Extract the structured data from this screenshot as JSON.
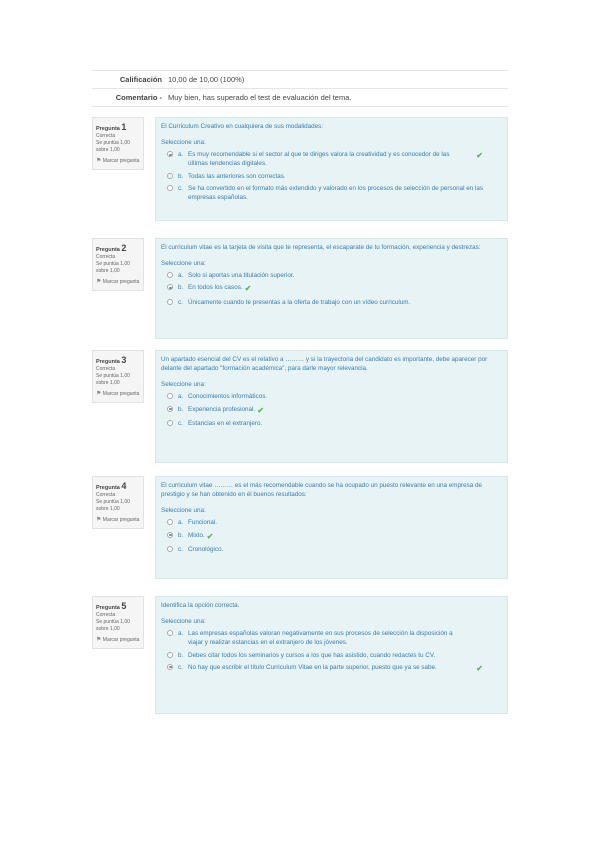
{
  "summary": [
    {
      "label": "Calificación",
      "value": "10,00 de 10,00 (100%)"
    },
    {
      "label": "Comentario -",
      "value": "Muy bien, has superado el test de evaluación del tema."
    }
  ],
  "questions": [
    {
      "label": "Pregunta",
      "number": "1",
      "status": "Correcta",
      "score": "Se puntúa 1,00 sobre 1,00",
      "flag": "Marcar pregunta",
      "text": "El Curriculum Creativo en cualquiera de sus modalidades:",
      "prompt": "Seleccione una:",
      "answers": [
        {
          "letter": "a.",
          "text": "Es muy recomendable si el sector al que te diriges valora la creatividad y es conocedor de las últimas tendencias digitales.",
          "selected": true,
          "correct": true
        },
        {
          "letter": "b.",
          "text": "Todas las anteriores son correctas.",
          "selected": false,
          "correct": false
        },
        {
          "letter": "c.",
          "text": "Se ha convertido en el formato más extendido y valorado en los procesos de selección de personal en las empresas españolas.",
          "selected": false,
          "correct": false
        }
      ]
    },
    {
      "label": "Pregunta",
      "number": "2",
      "status": "Correcta",
      "score": "Se puntúa 1,00 sobre 1,00",
      "flag": "Marcar pregunta",
      "text": "El curriculum vitae es la tarjeta de visita que te representa, el escaparate de tu formación, experiencia y destrezas:",
      "prompt": "Seleccione una:",
      "answers": [
        {
          "letter": "a.",
          "text": "Solo si aportas una titulación superior.",
          "selected": false,
          "correct": false
        },
        {
          "letter": "b.",
          "text": "En todos los casos.",
          "selected": true,
          "correct": true
        },
        {
          "letter": "c.",
          "text": "Únicamente cuando te presentas a la oferta de trabajo con un vídeo curriculum.",
          "selected": false,
          "correct": false
        }
      ]
    },
    {
      "label": "Pregunta",
      "number": "3",
      "status": "Correcta",
      "score": "Se puntúa 1,00 sobre 1,00",
      "flag": "Marcar pregunta",
      "text": "Un apartado esencial del CV es el relativo a ……… y si la trayectoria del candidato es importante, debe aparecer por delante del apartado \"formación académica\", para darle mayor relevancia.",
      "prompt": "Seleccione una:",
      "answers": [
        {
          "letter": "a.",
          "text": "Conocimientos informáticos.",
          "selected": false,
          "correct": false
        },
        {
          "letter": "b.",
          "text": "Experiencia profesional.",
          "selected": true,
          "correct": true
        },
        {
          "letter": "c.",
          "text": "Estancias en el extranjero.",
          "selected": false,
          "correct": false
        }
      ]
    },
    {
      "label": "Pregunta",
      "number": "4",
      "status": "Correcta",
      "score": "Se puntúa 1,00 sobre 1,00",
      "flag": "Marcar pregunta",
      "text": "El curriculum vitae ……… es el más recomendable cuando se ha ocupado un puesto relevante en una empresa de prestigio y se han obtenido en él buenos resultados:",
      "prompt": "Seleccione una:",
      "answers": [
        {
          "letter": "a.",
          "text": "Funcional.",
          "selected": false,
          "correct": false
        },
        {
          "letter": "b.",
          "text": "Mixto.",
          "selected": true,
          "correct": true
        },
        {
          "letter": "c.",
          "text": "Cronológico.",
          "selected": false,
          "correct": false
        }
      ]
    },
    {
      "label": "Pregunta",
      "number": "5",
      "status": "Correcta",
      "score": "Se puntúa 1,00 sobre 1,00",
      "flag": "Marcar pregunta",
      "text": "Identifica la opción correcta.",
      "prompt": "Seleccione una:",
      "answers": [
        {
          "letter": "a.",
          "text": "Las empresas españolas valoran negativamente en sus procesos de selección la disposición a viajar y realizar estancias en el extranjero de los jóvenes.",
          "selected": false,
          "correct": false
        },
        {
          "letter": "b.",
          "text": "Debes citar todos los seminarios y cursos a los que has asistido, cuando redactes tu CV.",
          "selected": false,
          "correct": false
        },
        {
          "letter": "c.",
          "text": "No hay que escribir el título Curriculum Vitae en la parte superior, puesto que ya se sabe.",
          "selected": true,
          "correct": true
        }
      ]
    }
  ],
  "icons": {
    "check": "check-icon",
    "flag": "flag-icon"
  },
  "colors": {
    "question_bg": "#e7f3f5",
    "question_text": "#3a7dae",
    "correct": "#5cb85c"
  }
}
